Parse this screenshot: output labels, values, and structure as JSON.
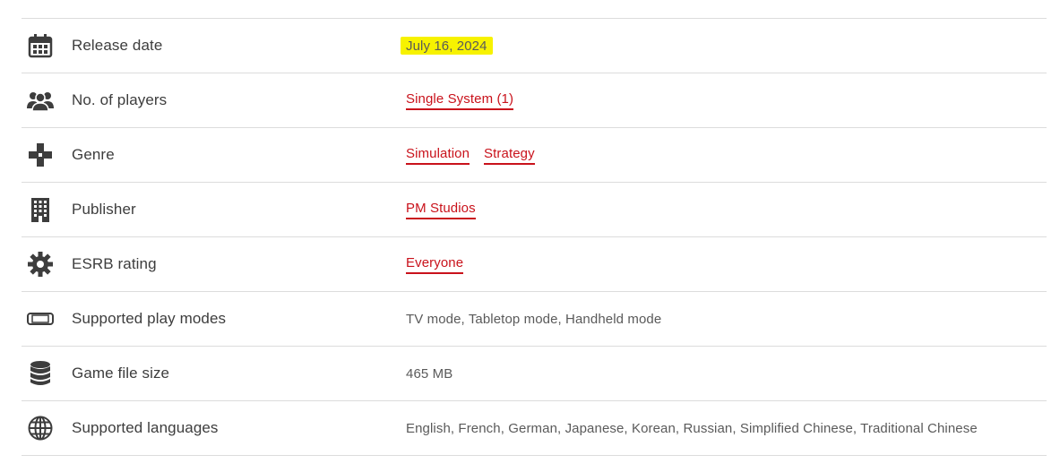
{
  "rows": [
    {
      "label": "Release date",
      "value": "July 16, 2024"
    },
    {
      "label": "No. of players",
      "links": [
        "Single System (1)"
      ]
    },
    {
      "label": "Genre",
      "links": [
        "Simulation",
        "Strategy"
      ]
    },
    {
      "label": "Publisher",
      "links": [
        "PM Studios"
      ]
    },
    {
      "label": "ESRB rating",
      "links": [
        "Everyone"
      ]
    },
    {
      "label": "Supported play modes",
      "value": "TV mode, Tabletop mode, Handheld mode"
    },
    {
      "label": "Game file size",
      "value": "465 MB"
    },
    {
      "label": "Supported languages",
      "value": "English, French, German, Japanese, Korean, Russian, Simplified Chinese, Traditional Chinese"
    }
  ],
  "colors": {
    "link": "#c9121b",
    "highlight": "#f7f200",
    "divider": "#dcdcdc"
  },
  "icons": [
    "calendar-icon",
    "players-icon",
    "dpad-icon",
    "building-icon",
    "gear-icon",
    "console-icon",
    "database-icon",
    "globe-icon"
  ]
}
